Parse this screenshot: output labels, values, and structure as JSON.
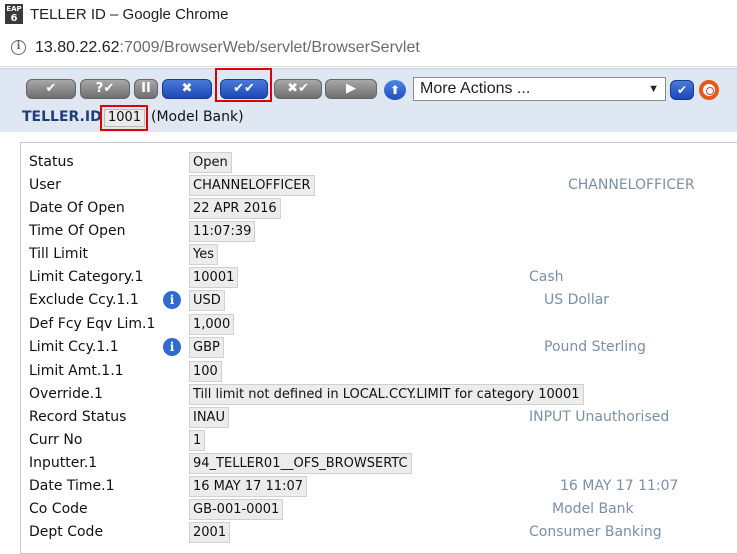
{
  "window": {
    "badge_top": "EAP",
    "badge_num": "6",
    "title": "TELLER ID – Google Chrome"
  },
  "address_bar": {
    "host": "13.80.22.62",
    "rest": ":7009/BrowserWeb/servlet/BrowserServlet"
  },
  "toolbar": {
    "buttons": [
      "✔",
      "?✔",
      "II",
      "✖",
      "✔✔",
      "✖✔",
      "▶"
    ],
    "up_symbol": "⬆",
    "actions_value": "More Actions ...",
    "actions_arrow": "▼",
    "go_symbol": "✔"
  },
  "record": {
    "label": "TELLER.ID",
    "id": "1001",
    "note": "(Model Bank)"
  },
  "fields": [
    {
      "label": "Status",
      "value": "Open",
      "desc": ""
    },
    {
      "label": "User",
      "value": "CHANNELOFFICER",
      "desc": "CHANNELOFFICER"
    },
    {
      "label": "Date Of Open",
      "value": "22 APR 2016",
      "desc": ""
    },
    {
      "label": "Time Of Open",
      "value": "11:07:39",
      "desc": ""
    },
    {
      "label": "Till Limit",
      "value": "Yes",
      "desc": ""
    },
    {
      "label": "Limit Category.1",
      "value": "10001",
      "desc": "Cash"
    },
    {
      "label": "Exclude Ccy.1.1",
      "value": "USD",
      "desc": "US Dollar"
    },
    {
      "label": "Def Fcy Eqv Lim.1",
      "value": "1,000",
      "desc": ""
    },
    {
      "label": "Limit Ccy.1.1",
      "value": "GBP",
      "desc": "Pound Sterling"
    },
    {
      "label": "Limit Amt.1.1",
      "value": "100",
      "desc": ""
    },
    {
      "label": "Override.1",
      "value": "Till limit not defined in LOCAL.CCY.LIMIT for category 10001",
      "desc": ""
    },
    {
      "label": "Record Status",
      "value": "INAU",
      "desc": "INPUT Unauthorised"
    },
    {
      "label": "Curr No",
      "value": "1",
      "desc": ""
    },
    {
      "label": "Inputter.1",
      "value": "94_TELLER01__OFS_BROWSERTC",
      "desc": ""
    },
    {
      "label": "Date Time.1",
      "value": "16 MAY 17 11:07",
      "desc": "16 MAY 17 11:07"
    },
    {
      "label": "Co Code",
      "value": "GB-001-0001",
      "desc": "Model Bank"
    },
    {
      "label": "Dept Code",
      "value": "2001",
      "desc": "Consumer Banking"
    }
  ],
  "info_symbol": "i",
  "colors": {
    "highlight": "#e00000",
    "toolbar_bg": "#dfe7f2",
    "desc_text": "#7a8fa8",
    "label_blue": "#1f3f7a"
  }
}
